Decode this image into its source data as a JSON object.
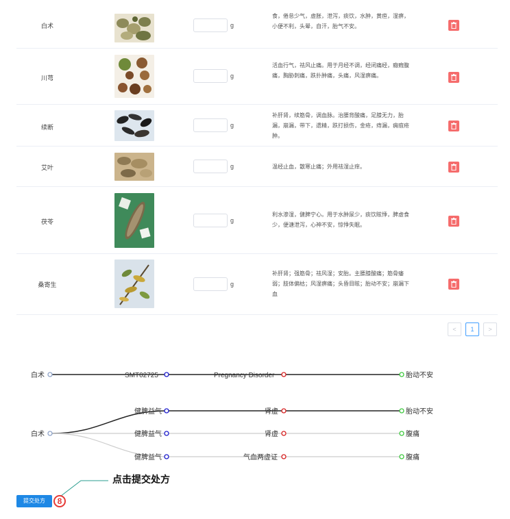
{
  "herbs": [
    {
      "name": "白术",
      "dose": "",
      "unit": "g",
      "description": "补脾，益胃，燥湿，和中，安胎。治脾胃气弱，不思饮食，倦怠少气，虚胀，泄泻，痰饮，水肿，黄疸，湿痹，小便不利，头晕，自汗，胎气不安。"
    },
    {
      "name": "川芎",
      "dose": "",
      "unit": "g",
      "description": "活血行气，祛风止痛。用于月经不调，经闭痛经，癥瘕腹痛，胸胁刺痛，跌扑肿痛，头痛，风湿痹痛。"
    },
    {
      "name": "续断",
      "dose": "",
      "unit": "g",
      "description": "补肝肾，续筋骨，调血脉。治腰背酸痛，足膝无力，胎漏，崩漏，带下，遗精，跌打损伤，金疮，痔漏，痈疽疮肿。"
    },
    {
      "name": "艾叶",
      "dose": "",
      "unit": "g",
      "description": "温经止血，散寒止痛；外用祛湿止痒。"
    },
    {
      "name": "茯苓",
      "dose": "",
      "unit": "g",
      "description": "利水渗湿，健脾宁心。用于水肿尿少，痰饮眩悸，脾虚食少，便溏泄泻，心神不安，惊悸失眠。"
    },
    {
      "name": "桑寄生",
      "dose": "",
      "unit": "g",
      "description": "补肝肾；强筋骨；祛风湿；安胎。主腰膝酸痛；筋骨痿弱；肢体偏枯；风湿痹痛；头昏目眩；胎动不安；崩漏下血"
    }
  ],
  "pagination": {
    "prev": "<",
    "current": "1",
    "next": ">"
  },
  "graph": {
    "path1": [
      "白术",
      "SMT02725",
      "Pregnancy Disorder",
      "胎动不安"
    ],
    "root": "白术",
    "branches": [
      [
        "健脾益气",
        "肾虚",
        "胎动不安"
      ],
      [
        "健脾益气",
        "肾虚",
        "腹痛"
      ],
      [
        "健脾益气",
        "气血两虚证",
        "腹痛"
      ]
    ],
    "colors": {
      "start": "#8fa3c8",
      "mid": "#1c1ccc",
      "dx": "#d62020",
      "end": "#3ec93e"
    }
  },
  "submit_label": "提交处方",
  "badge": "8",
  "annotation": "点击提交处方"
}
